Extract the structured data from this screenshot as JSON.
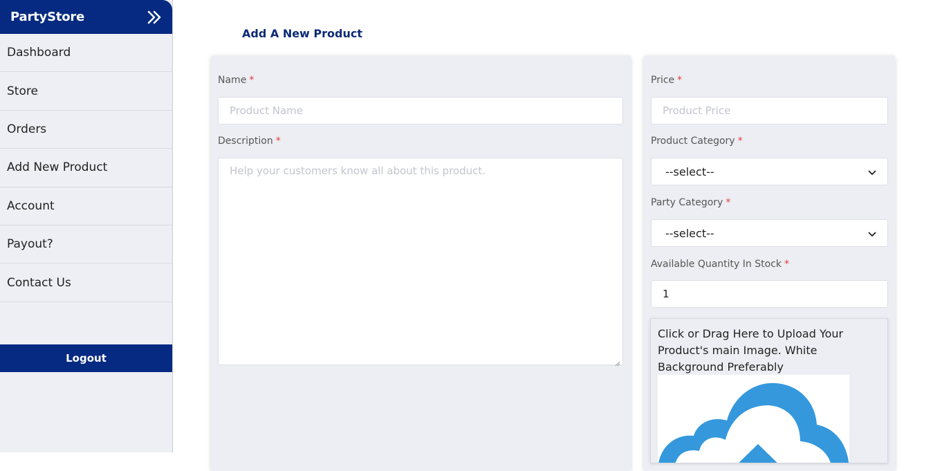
{
  "sidebar": {
    "brand": "PartyStore",
    "items": [
      {
        "label": "Dashboard"
      },
      {
        "label": "Store"
      },
      {
        "label": "Orders"
      },
      {
        "label": "Add New Product"
      },
      {
        "label": "Account"
      },
      {
        "label": "Payout?"
      },
      {
        "label": "Contact Us"
      }
    ],
    "logout": "Logout"
  },
  "page": {
    "title": "Add A New Product"
  },
  "form": {
    "name": {
      "label": "Name",
      "required": "*",
      "placeholder": "Product Name"
    },
    "description": {
      "label": "Description",
      "required": "*",
      "placeholder": "Help your customers know all about this product."
    },
    "price": {
      "label": "Price",
      "required": "*",
      "placeholder": "Product Price"
    },
    "product_category": {
      "label": "Product Category",
      "required": "*",
      "selected": "--select--"
    },
    "party_category": {
      "label": "Party Category",
      "required": "*",
      "selected": "--select--"
    },
    "quantity": {
      "label": "Available Quantity In Stock",
      "required": "*",
      "value": "1"
    },
    "upload": {
      "text": "Click or Drag Here to Upload Your Product's main Image. White Background Preferably"
    }
  },
  "colors": {
    "brand": "#062a81",
    "required": "#e23b3b",
    "cloud": "#3598dc"
  },
  "icons": [
    "double-chevron-right-icon",
    "chevron-down-icon",
    "resize-grip-icon",
    "cloud-upload-icon"
  ]
}
